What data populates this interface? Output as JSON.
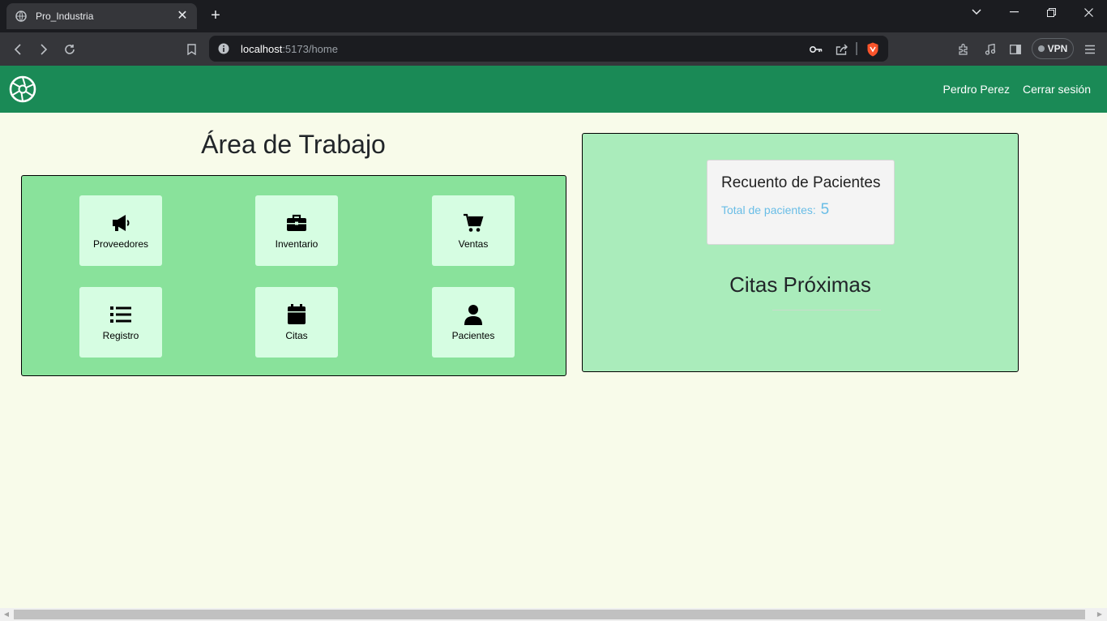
{
  "browser": {
    "tab_title": "Pro_Industria",
    "url_host": "localhost",
    "url_path": ":5173/home",
    "vpn_label": "VPN"
  },
  "header": {
    "user_name": "Perdro Perez",
    "logout_label": "Cerrar sesión"
  },
  "workspace": {
    "title": "Área de Trabajo",
    "tiles": [
      {
        "label": "Proveedores",
        "icon": "megaphone-icon"
      },
      {
        "label": "Inventario",
        "icon": "briefcase-icon"
      },
      {
        "label": "Ventas",
        "icon": "shopping-cart-icon"
      },
      {
        "label": "Registro",
        "icon": "list-icon"
      },
      {
        "label": "Citas",
        "icon": "calendar-icon"
      },
      {
        "label": "Pacientes",
        "icon": "user-icon"
      }
    ]
  },
  "patients": {
    "title": "Recuento de Pacientes",
    "total_label": "Total de pacientes:",
    "total_value": "5"
  },
  "appointments": {
    "title": "Citas Próximas"
  },
  "colors": {
    "header": "#1a8a56",
    "page_bg": "#f8fbea",
    "work_panel": "#89e29b",
    "tile": "#d6fde2",
    "right_panel": "#aaecbb",
    "count_text": "#69bde6"
  }
}
